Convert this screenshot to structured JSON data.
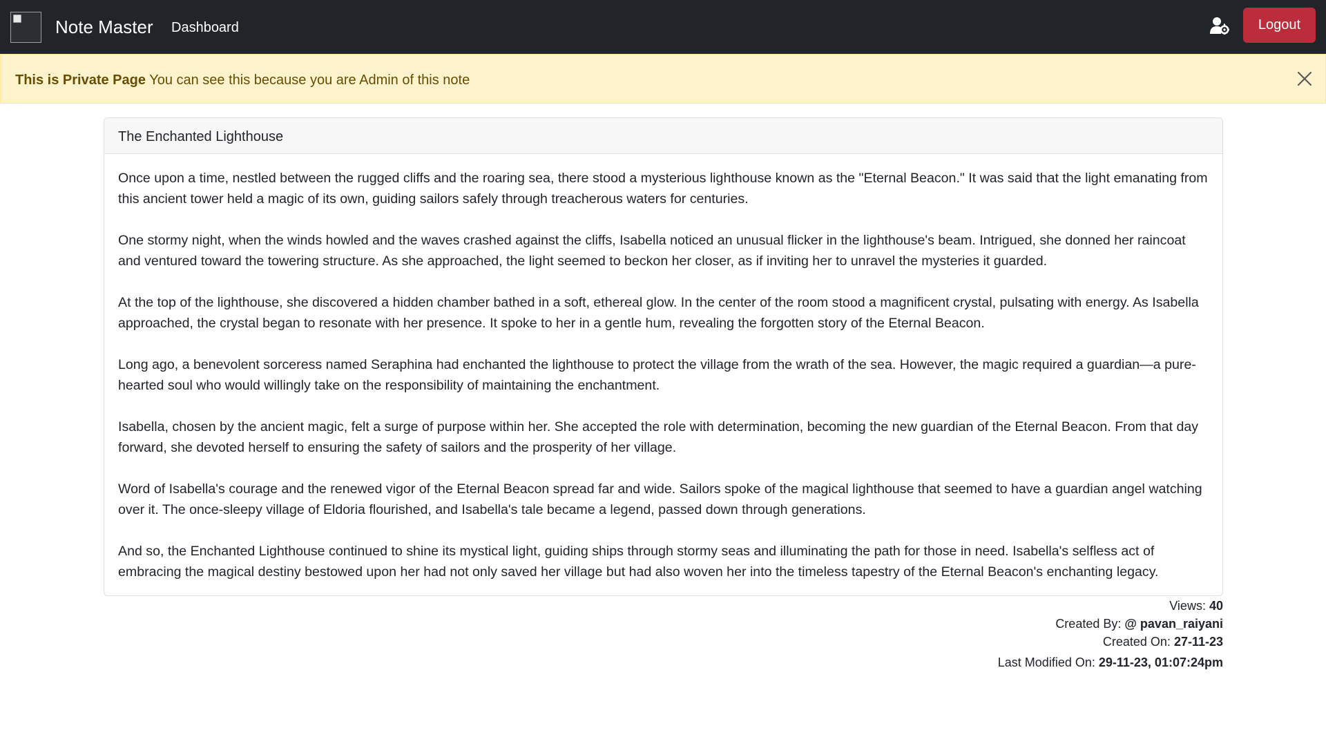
{
  "navbar": {
    "brand": "Note Master",
    "dashboard_link": "Dashboard",
    "logout_label": "Logout"
  },
  "alert": {
    "title": "This is Private Page",
    "message": "You can see this because you are Admin of this note"
  },
  "note": {
    "title": "The Enchanted Lighthouse",
    "paragraphs": [
      "Once upon a time, nestled between the rugged cliffs and the roaring sea, there stood a mysterious lighthouse known as the \"Eternal Beacon.\" It was said that the light emanating from this ancient tower held a magic of its own, guiding sailors safely through treacherous waters for centuries.",
      "One stormy night, when the winds howled and the waves crashed against the cliffs, Isabella noticed an unusual flicker in the lighthouse's beam. Intrigued, she donned her raincoat and ventured toward the towering structure. As she approached, the light seemed to beckon her closer, as if inviting her to unravel the mysteries it guarded.",
      "At the top of the lighthouse, she discovered a hidden chamber bathed in a soft, ethereal glow. In the center of the room stood a magnificent crystal, pulsating with energy. As Isabella approached, the crystal began to resonate with her presence. It spoke to her in a gentle hum, revealing the forgotten story of the Eternal Beacon.",
      "Long ago, a benevolent sorceress named Seraphina had enchanted the lighthouse to protect the village from the wrath of the sea. However, the magic required a guardian—a pure-hearted soul who would willingly take on the responsibility of maintaining the enchantment.",
      "Isabella, chosen by the ancient magic, felt a surge of purpose within her. She accepted the role with determination, becoming the new guardian of the Eternal Beacon. From that day forward, she devoted herself to ensuring the safety of sailors and the prosperity of her village.",
      "Word of Isabella's courage and the renewed vigor of the Eternal Beacon spread far and wide. Sailors spoke of the magical lighthouse that seemed to have a guardian angel watching over it. The once-sleepy village of Eldoria flourished, and Isabella's tale became a legend, passed down through generations.",
      "And so, the Enchanted Lighthouse continued to shine its mystical light, guiding ships through stormy seas and illuminating the path for those in need. Isabella's selfless act of embracing the magical destiny bestowed upon her had not only saved her village but had also woven her into the timeless tapestry of the Eternal Beacon's enchanting legacy."
    ]
  },
  "meta": {
    "views_label": "Views:",
    "views_value": "40",
    "created_by_label": "Created By:",
    "created_by_value": "@ pavan_raiyani",
    "created_on_label": "Created On:",
    "created_on_value": "27-11-23",
    "modified_label": "Last Modified On:",
    "modified_value": "29-11-23, 01:07:24pm"
  }
}
